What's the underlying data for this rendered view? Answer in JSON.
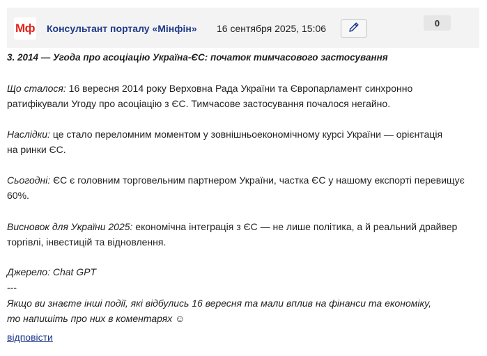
{
  "comment": {
    "logo_text": "Мф",
    "author": "Консультант порталу «Мінфін»",
    "date": "16 сентября 2025, 15:06",
    "counter": "0",
    "edit_icon": "pencil-icon",
    "title": "3. 2014 — Угода про асоціацію Україна-ЄС: початок тимчасового застосування",
    "what_happened": {
      "label": "Що сталося:",
      "line1": " 16 вересня 2014 року Верховна Рада України та Європарламент синхронно",
      "line2": "ратифікували Угоду про асоціацію з ЄС. Тимчасове застосування почалося негайно."
    },
    "consequences": {
      "label": "Наслідки:",
      "line1": " це стало переломним моментом у зовнішньоекономічному курсі України — орієнтація",
      "line2": "на ринки ЄС."
    },
    "today": {
      "label": "Сьогодні:",
      "line1": " ЄС є головним торговельним партнером України, частка ЄС у нашому експорті перевищує",
      "line2": "60%."
    },
    "conclusion": {
      "label": "Висновок для України 2025:",
      "line1": " економічна інтеграція з ЄС — не лише політика, а й реальний драйвер",
      "line2": "торгівлі, інвестицій та відновлення."
    },
    "source": "Джерело: Chat GPT",
    "separator": "---",
    "call_line1": "Якщо ви знаєте інші події, які відбулись 16 вересня та мали вплив на фінанси та економіку,",
    "call_line2": "то напишіть про них в коментарях ☺",
    "reply_label": "відповісти"
  },
  "colors": {
    "header_bg": "#f3f3f3",
    "author": "#1f3a8a",
    "logo": "#e2231a",
    "link": "#1f3a8a"
  }
}
